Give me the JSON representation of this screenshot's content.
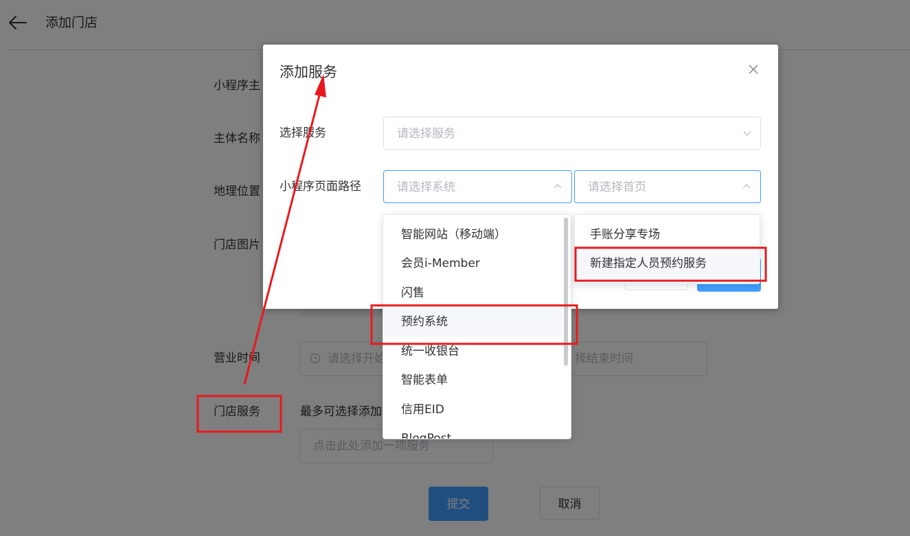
{
  "page": {
    "title": "添加门店",
    "form": {
      "label_1": "小程序主",
      "label_2": "主体名称",
      "label_3": "地理位置",
      "label_4": "门店图片",
      "business_hours_label": "营业时间",
      "start_time_placeholder": "请选择开始",
      "end_time_placeholder": "择结束时间",
      "store_service_label": "门店服务",
      "service_hint": "最多可选择添加",
      "add_service_placeholder": "点击此处添加一项服务"
    },
    "submit_label": "提交",
    "cancel_label": "取消"
  },
  "dialog": {
    "title": "添加服务",
    "service_label": "选择服务",
    "service_placeholder": "请选择服务",
    "path_label": "小程序页面路径",
    "system_placeholder": "请选择系统",
    "home_placeholder": "请选择首页"
  },
  "system_dropdown": {
    "items": [
      "智能网站（移动端）",
      "会员i-Member",
      "闪售",
      "预约系统",
      "统一收银台",
      "智能表单",
      "信用EID",
      "BlogPost"
    ],
    "hovered_index": 3
  },
  "home_dropdown": {
    "items": [
      "手账分享专场",
      "新建指定人员预约服务"
    ],
    "hovered_index": 1
  },
  "colors": {
    "primary": "#409eff",
    "annotation": "#e8191e",
    "overlay": "rgba(0,0,0,0.5)"
  }
}
